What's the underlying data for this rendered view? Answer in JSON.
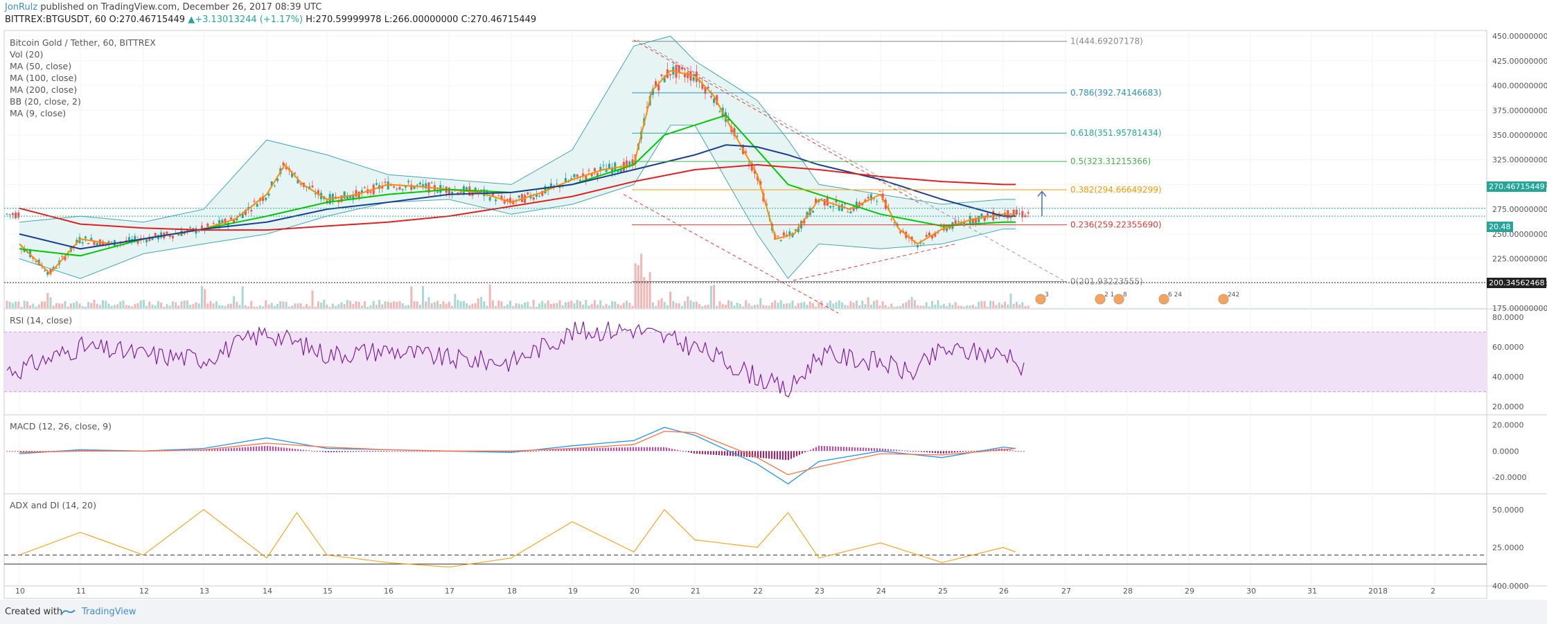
{
  "header": {
    "user": "JonRulz",
    "published": " published on TradingView.com, December 26, 2017 08:39 UTC",
    "symbol": "BITTREX:BTGUSDT, 60",
    "open_label": "O:",
    "open": "270.46715449",
    "change": "+3.13013244 (+1.17%)",
    "high_label": "H:",
    "high": "270.59999978",
    "low_label": "L:",
    "low": "266.00000000",
    "close_label": "C:",
    "close": "270.46715449"
  },
  "legend": [
    "Bitcoin Gold / Tether, 60, BITTREX",
    "Vol (20)",
    "MA (50, close)",
    "MA (100, close)",
    "MA (200, close)",
    "BB (20, close, 2)",
    "MA (9, close)"
  ],
  "panes": {
    "rsi_title": "RSI (14, close)",
    "macd_title": "MACD (12, 26, close, 9)",
    "adx_title": "ADX and DI (14, 20)"
  },
  "price_labels": {
    "last": "270.46715449",
    "vol": "20.48",
    "line": "200.34562468"
  },
  "fib_levels": [
    {
      "ratio": "1",
      "label": "1(444.69207178)",
      "value": 444.69,
      "color": "#888888"
    },
    {
      "ratio": "0.786",
      "label": "0.786(392.74146683)",
      "value": 392.74,
      "color": "#2d8fc1"
    },
    {
      "ratio": "0.618",
      "label": "0.618(351.95781434)",
      "value": 351.96,
      "color": "#26a69a"
    },
    {
      "ratio": "0.5",
      "label": "0.5(323.31215366)",
      "value": 323.31,
      "color": "#4caf50"
    },
    {
      "ratio": "0.382",
      "label": "0.382(294.66649299)",
      "value": 294.67,
      "color": "#ff9800"
    },
    {
      "ratio": "0.236",
      "label": "0.236(259.22355690)",
      "value": 259.22,
      "color": "#e53935"
    },
    {
      "ratio": "0",
      "label": "0(201.93223555)",
      "value": 201.93,
      "color": "#888888"
    }
  ],
  "events": [
    "3",
    "2 1",
    "8",
    "6 24",
    "242"
  ],
  "footer": {
    "created": "Created with",
    "brand": "TradingView"
  },
  "colors": {
    "ma50": "#00c800",
    "ma100": "#1a3f8f",
    "ma200": "#e02020",
    "ma9": "#ff8c00",
    "bb": "#3fa7b5",
    "rsi": "#7b1fa2",
    "macd": "#2196f3",
    "signal": "#ff7043",
    "adx": "#f5a623",
    "up": "#26a69a",
    "down": "#ef5350"
  },
  "chart_data": [
    {
      "type": "line",
      "title": "Bitcoin Gold / Tether, 60, BITTREX",
      "x": [
        "10",
        "11",
        "12",
        "13",
        "14",
        "15",
        "16",
        "17",
        "18",
        "19",
        "20",
        "21",
        "22",
        "23",
        "24",
        "25",
        "26",
        "27",
        "28",
        "29",
        "30",
        "31",
        "2018",
        "2"
      ],
      "ylim": [
        175,
        455
      ],
      "y_ticks": [
        "175.00000000",
        "200.00000000",
        "225.00000000",
        "250.00000000",
        "275.00000000",
        "300.00000000",
        "325.00000000",
        "350.00000000",
        "375.00000000",
        "400.00000000",
        "425.00000000",
        "450.00000000"
      ],
      "series": [
        {
          "name": "MA (9, close)",
          "x": [
            "10",
            "10.5",
            "11",
            "11.5",
            "12",
            "12.5",
            "13",
            "13.5",
            "14",
            "14.3",
            "14.6",
            "15",
            "15.5",
            "16",
            "16.5",
            "17",
            "17.5",
            "18",
            "18.5",
            "19",
            "19.5",
            "20",
            "20.3",
            "20.6",
            "21",
            "21.3",
            "21.6",
            "22",
            "22.3",
            "22.6",
            "23",
            "23.5",
            "24",
            "24.3",
            "24.6",
            "25",
            "25.5",
            "26",
            "26.2"
          ],
          "values": [
            240,
            210,
            245,
            240,
            245,
            250,
            255,
            265,
            290,
            320,
            300,
            285,
            290,
            300,
            298,
            295,
            292,
            282,
            292,
            305,
            315,
            320,
            395,
            415,
            410,
            390,
            355,
            310,
            245,
            250,
            285,
            275,
            290,
            255,
            240,
            255,
            265,
            270,
            270
          ]
        },
        {
          "name": "MA (50, close)",
          "x": [
            "10",
            "11",
            "12",
            "13",
            "14",
            "15",
            "16",
            "17",
            "18",
            "19",
            "20",
            "20.5",
            "21",
            "21.5",
            "22",
            "22.5",
            "23",
            "24",
            "25",
            "26",
            "26.2"
          ],
          "values": [
            235,
            228,
            245,
            255,
            268,
            282,
            290,
            295,
            292,
            300,
            320,
            350,
            360,
            370,
            335,
            300,
            290,
            270,
            258,
            262,
            262
          ]
        },
        {
          "name": "MA (100, close)",
          "x": [
            "10",
            "11",
            "12",
            "13",
            "14",
            "15",
            "16",
            "17",
            "18",
            "19",
            "20",
            "21",
            "21.5",
            "22",
            "22.5",
            "23",
            "24",
            "25",
            "26",
            "26.2"
          ],
          "values": [
            250,
            235,
            245,
            255,
            262,
            275,
            282,
            290,
            292,
            300,
            315,
            330,
            340,
            338,
            330,
            320,
            305,
            285,
            268,
            268
          ]
        },
        {
          "name": "MA (200, close)",
          "x": [
            "10",
            "11",
            "12",
            "13",
            "14",
            "15",
            "16",
            "17",
            "18",
            "19",
            "20",
            "21",
            "22",
            "23",
            "24",
            "25",
            "26",
            "26.2"
          ],
          "values": [
            276,
            260,
            256,
            254,
            254,
            258,
            262,
            268,
            278,
            288,
            303,
            315,
            320,
            315,
            308,
            303,
            300,
            300
          ]
        }
      ]
    },
    {
      "type": "line",
      "title": "RSI (14, close)",
      "x": [
        "10",
        "11",
        "12",
        "13",
        "14",
        "15",
        "16",
        "17",
        "18",
        "19",
        "20",
        "21",
        "22",
        "22.5",
        "23",
        "24",
        "24.5",
        "25",
        "26",
        "26.2"
      ],
      "ylim": [
        15,
        85
      ],
      "y_ticks": [
        "20.0000",
        "40.0000",
        "60.0000",
        "80.0000"
      ],
      "series": [
        {
          "name": "RSI",
          "values": [
            45,
            60,
            55,
            52,
            70,
            55,
            58,
            52,
            50,
            70,
            72,
            60,
            40,
            30,
            55,
            50,
            42,
            58,
            55,
            56
          ]
        }
      ]
    },
    {
      "type": "line",
      "title": "MACD (12, 26, close, 9)",
      "x": [
        "10",
        "11",
        "12",
        "13",
        "14",
        "15",
        "16",
        "17",
        "18",
        "19",
        "20",
        "20.5",
        "21",
        "22",
        "22.5",
        "23",
        "24",
        "25",
        "26",
        "26.2"
      ],
      "ylim": [
        -32,
        27
      ],
      "y_ticks": [
        "-20.0000",
        "0.0000",
        "20.0000"
      ],
      "series": [
        {
          "name": "MACD",
          "values": [
            -2,
            1,
            0,
            2,
            10,
            2,
            1,
            0,
            -1,
            4,
            8,
            18,
            12,
            -10,
            -25,
            -8,
            0,
            -5,
            3,
            2
          ]
        },
        {
          "name": "Signal",
          "values": [
            -1,
            0,
            0,
            1,
            6,
            3,
            1,
            0,
            0,
            2,
            5,
            15,
            14,
            -5,
            -18,
            -12,
            -2,
            -3,
            1,
            2
          ]
        }
      ]
    },
    {
      "type": "line",
      "title": "ADX and DI (14, 20)",
      "x": [
        "10",
        "11",
        "12",
        "13",
        "14",
        "14.5",
        "15",
        "16",
        "17",
        "18",
        "19",
        "20",
        "20.5",
        "21",
        "22",
        "22.5",
        "23",
        "24",
        "25",
        "26",
        "26.2"
      ],
      "ylim": [
        0,
        60
      ],
      "y_ticks": [
        "25.0000",
        "50.0000",
        "400.0000"
      ],
      "series": [
        {
          "name": "ADX",
          "values": [
            20,
            35,
            20,
            50,
            18,
            48,
            20,
            15,
            12,
            18,
            42,
            22,
            50,
            30,
            25,
            48,
            18,
            28,
            15,
            25,
            22
          ]
        }
      ]
    }
  ]
}
